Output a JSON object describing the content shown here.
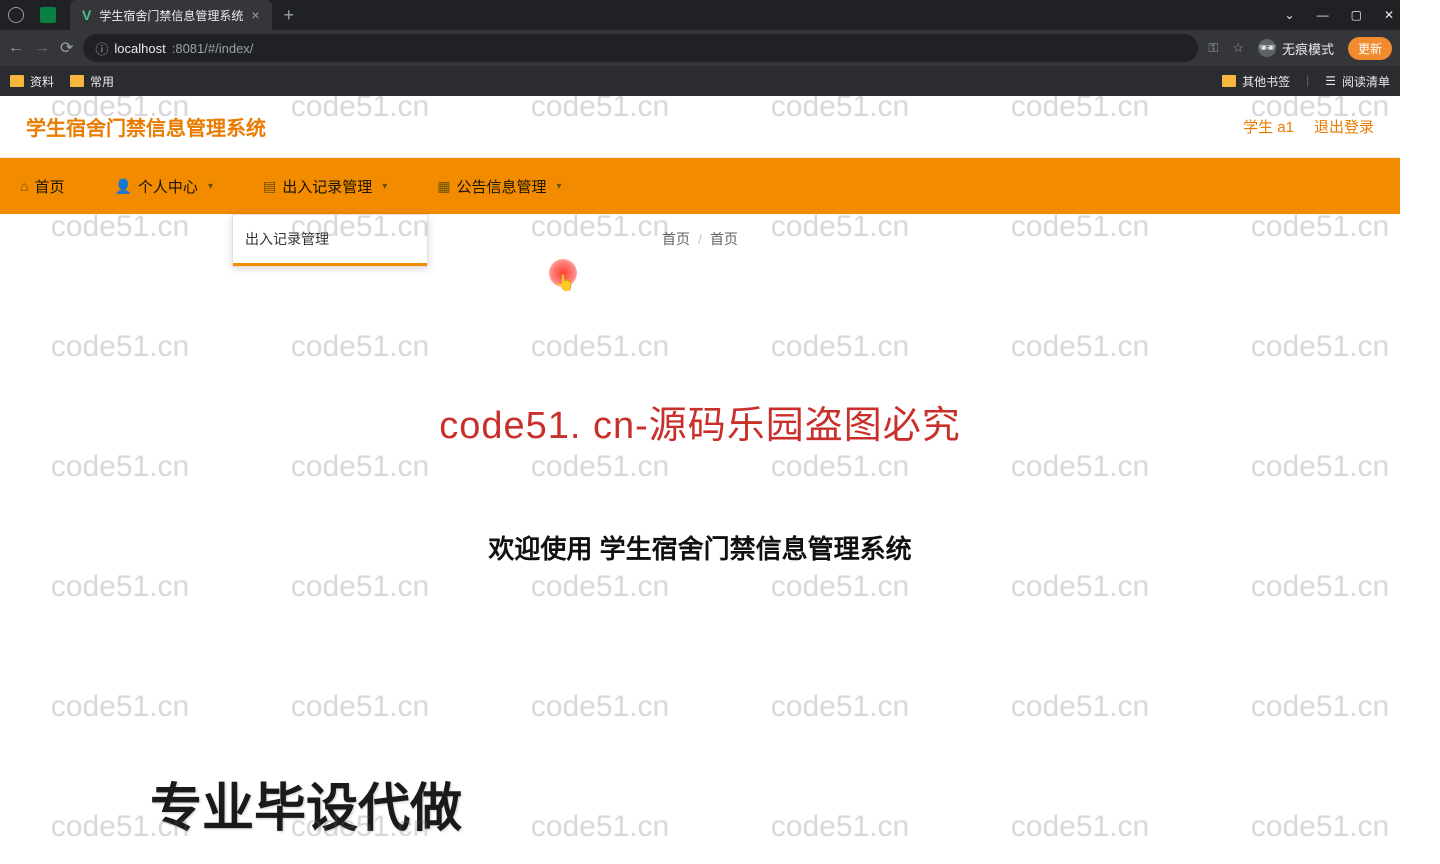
{
  "browser": {
    "tab_title": "学生宿舍门禁信息管理系统",
    "url_prefix": "localhost",
    "url_port_path": ":8081/#/index/",
    "incognito_label": "无痕模式",
    "update_label": "更新"
  },
  "bookmarks": {
    "left": [
      "资料",
      "常用"
    ],
    "right": [
      "其他书签",
      "阅读清单"
    ]
  },
  "app": {
    "title": "学生宿舍门禁信息管理系统",
    "user": "学生 a1",
    "logout": "退出登录"
  },
  "nav": {
    "items": [
      {
        "label": "首页",
        "has_chevron": false
      },
      {
        "label": "个人中心",
        "has_chevron": true
      },
      {
        "label": "出入记录管理",
        "has_chevron": true
      },
      {
        "label": "公告信息管理",
        "has_chevron": true
      }
    ]
  },
  "dropdown": {
    "item": "出入记录管理"
  },
  "breadcrumb": {
    "a": "首页",
    "b": "首页"
  },
  "content": {
    "red_banner": "code51. cn-源码乐园盗图必究",
    "welcome": "欢迎使用 学生宿舍门禁信息管理系统",
    "big_text": "专业毕设代做"
  },
  "watermark": "code51.cn"
}
